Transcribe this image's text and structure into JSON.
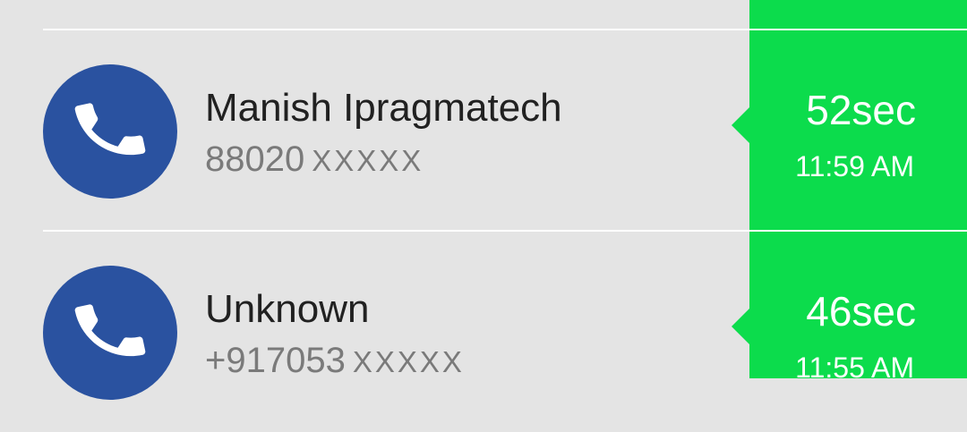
{
  "calls": [
    {
      "name": "Manish Ipragmatech",
      "number_digits": "88020",
      "number_mask": "XXXXX",
      "duration": "52sec",
      "time": "11:59 AM",
      "icon": "phone-icon"
    },
    {
      "name": "Unknown",
      "number_digits": "+917053",
      "number_mask": "XXXXX",
      "duration": "46sec",
      "time": "11:55 AM",
      "icon": "phone-icon"
    }
  ],
  "colors": {
    "background": "#e4e4e4",
    "accent_green": "#0cdc4c",
    "avatar_blue": "#2a52a0",
    "name_text": "#212121",
    "number_text": "#7a7a7a"
  }
}
